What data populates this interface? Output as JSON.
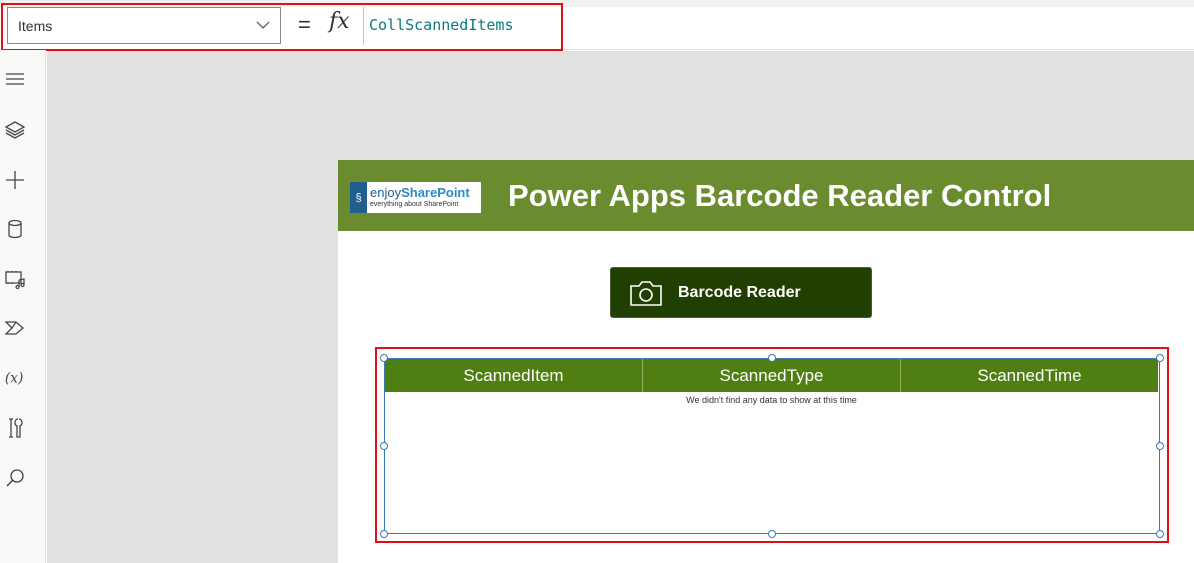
{
  "formula_bar": {
    "property": "Items",
    "equals": "=",
    "fx": "fx",
    "formula": "CollScannedItems"
  },
  "left_rail": {
    "icons": [
      "hamburger-menu-icon",
      "layers-icon",
      "add-icon",
      "data-icon",
      "media-icon",
      "power-automate-icon",
      "variables-icon",
      "advanced-tools-icon",
      "search-icon"
    ]
  },
  "app": {
    "logo": {
      "brand_prefix": "enjoy",
      "brand_suffix": "SharePoint",
      "tagline": "everything about SharePoint"
    },
    "title": "Power Apps Barcode Reader Control",
    "button_label": "Barcode Reader",
    "table": {
      "columns": [
        "ScannedItem",
        "ScannedType",
        "ScannedTime"
      ],
      "empty_message": "We didn't find any data to show at this time"
    }
  },
  "colors": {
    "header": "#6a8b2e",
    "button": "#213f00",
    "table_header": "#4f7f12",
    "highlight": "#e0101b",
    "selection": "#3e7ab5"
  }
}
